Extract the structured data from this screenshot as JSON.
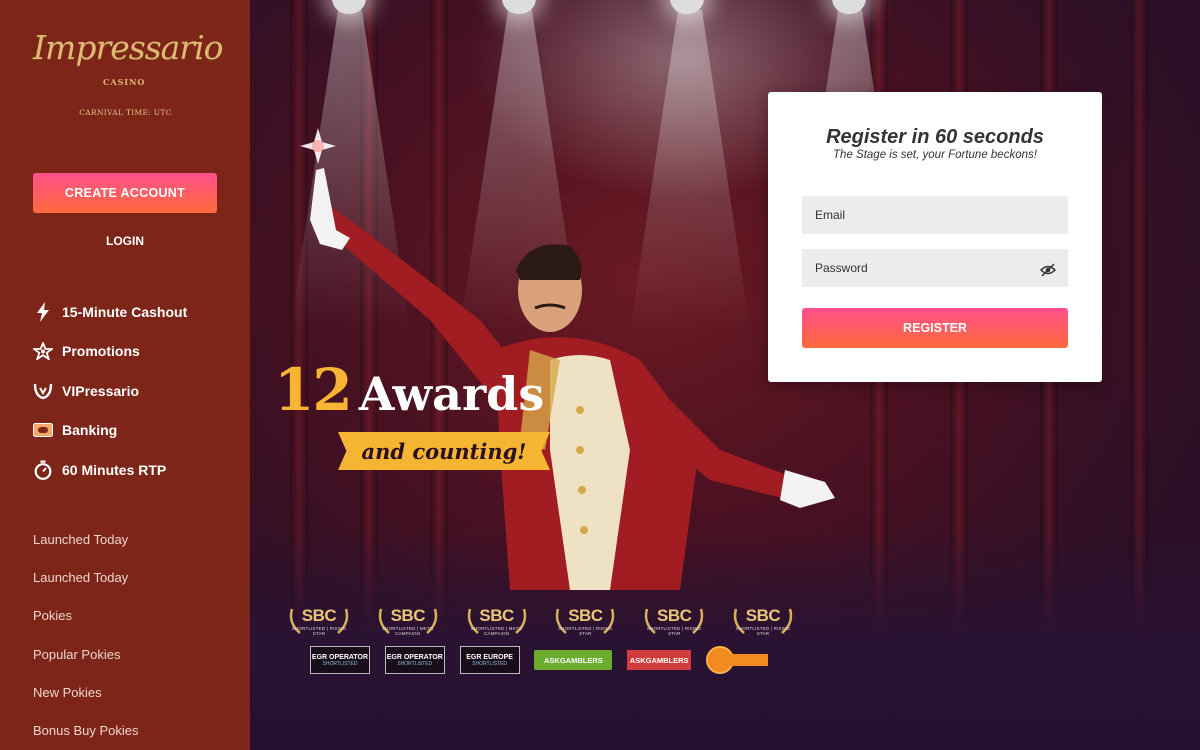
{
  "sidebar": {
    "logo_text": "Impressario",
    "logo_sub": "CASINO",
    "carnival_time": "CARNIVAL TIME: UTC",
    "create_account": "CREATE ACCOUNT",
    "login": "LOGIN",
    "menu": [
      {
        "label": "15-Minute Cashout",
        "icon": "lightning-icon"
      },
      {
        "label": "Promotions",
        "icon": "star-icon"
      },
      {
        "label": "VIPressario",
        "icon": "vip-icon"
      },
      {
        "label": "Banking",
        "icon": "banking-icon"
      },
      {
        "label": "60 Minutes RTP",
        "icon": "stopwatch-icon"
      }
    ],
    "categories": [
      "Launched Today",
      "Launched Today",
      "Pokies",
      "Popular Pokies",
      "New Pokies",
      "Bonus Buy Pokies"
    ]
  },
  "hero": {
    "awards_number": "12",
    "awards_word": "Awards",
    "ribbon_text": "and counting!",
    "sbc_badges": [
      {
        "title": "SBC",
        "subtitle": "SHORTLISTED | RISING STAR"
      },
      {
        "title": "SBC",
        "subtitle": "SHORTLISTED | MKTG CAMPAIGN"
      },
      {
        "title": "SBC",
        "subtitle": "SHORTLISTED | MKTG CAMPAIGN"
      },
      {
        "title": "SBC",
        "subtitle": "SHORTLISTED | RISING STAR"
      },
      {
        "title": "SBC",
        "subtitle": "SHORTLISTED | RISING STAR"
      },
      {
        "title": "SBC",
        "subtitle": "SHORTLISTED | RISING STAR"
      }
    ],
    "egr_badges": [
      {
        "title": "EGR OPERATOR",
        "subtitle": "SHORTLISTED"
      },
      {
        "title": "EGR OPERATOR",
        "subtitle": "SHORTLISTED"
      },
      {
        "title": "EGR EUROPE",
        "subtitle": "SHORTLISTED"
      }
    ],
    "askgamblers_green": "ASKGAMBLERS",
    "askgamblers_red": "ASKGAMBLERS"
  },
  "register": {
    "title": "Register in 60 seconds",
    "subtitle": "The Stage is set, your Fortune beckons!",
    "email_placeholder": "Email",
    "password_placeholder": "Password",
    "button": "REGISTER"
  },
  "colors": {
    "sidebar_bg": "#7c2518",
    "accent_start": "#ff4f8a",
    "accent_end": "#ff6a3c",
    "gold": "#f7b533"
  }
}
